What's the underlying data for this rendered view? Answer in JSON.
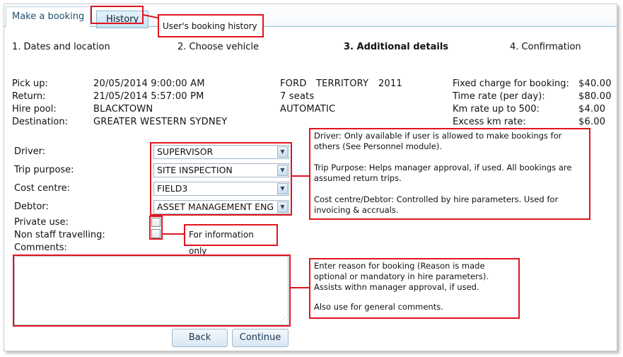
{
  "tabs": [
    {
      "label": "Make a booking"
    },
    {
      "label": "History"
    }
  ],
  "steps": [
    {
      "label": "1. Dates and location"
    },
    {
      "label": "2. Choose vehicle"
    },
    {
      "label": "3. Additional details"
    },
    {
      "label": "4. Confirmation"
    }
  ],
  "booking": {
    "rows": [
      {
        "label": "Pick up:",
        "value": "20/05/2014 9:00:00 AM"
      },
      {
        "label": "Return:",
        "value": "21/05/2014 5:57:00 PM"
      },
      {
        "label": "Hire pool:",
        "value": "BLACKTOWN"
      },
      {
        "label": "Destination:",
        "value": "GREATER WESTERN SYDNEY"
      }
    ]
  },
  "vehicle": {
    "make": "FORD",
    "model": "TERRITORY",
    "year": "2011",
    "seats": "7 seats",
    "transmission": "AUTOMATIC"
  },
  "rates": [
    {
      "label": "Fixed charge for booking:",
      "value": "$40.00"
    },
    {
      "label": "Time rate (per day):",
      "value": "$80.00"
    },
    {
      "label": "Km rate up to 500:",
      "value": "$4.00"
    },
    {
      "label": "Excess km rate:",
      "value": "$6.00"
    }
  ],
  "form": {
    "driver_label": "Driver:",
    "driver_value": "SUPERVISOR",
    "trip_label": "Trip purpose:",
    "trip_value": "SITE INSPECTION",
    "cost_label": "Cost centre:",
    "cost_value": "FIELD3",
    "debtor_label": "Debtor:",
    "debtor_value": "ASSET MANAGEMENT ENG",
    "private_label": "Private use:",
    "private_checked": false,
    "nonstaff_label": "Non staff travelling:",
    "nonstaff_checked": false,
    "comments_label": "Comments:",
    "comments_value": ""
  },
  "buttons": {
    "back": "Back",
    "continue": "Continue"
  },
  "callouts": {
    "history": "User's booking history",
    "selects_driver": "Driver: Only available if user is allowed to make bookings for others (See Personnel module).",
    "selects_trip": "Trip Purpose: Helps manager approval, if used. All bookings are assumed return trips.",
    "selects_cost": "Cost centre/Debtor: Controlled by hire parameters.  Used for invoicing & accruals.",
    "info_only": "For information only",
    "comments_1": "Enter reason for booking (Reason is made optional or mandatory in hire parameters). Assists withn manager approval, if used.",
    "comments_2": "Also use for general comments."
  },
  "colors": {
    "annotation_red": "#e1141e",
    "tab_border": "#86b8d6"
  }
}
